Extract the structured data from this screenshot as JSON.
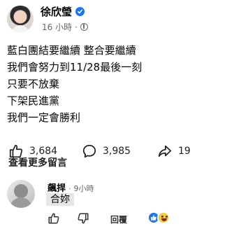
{
  "post": {
    "author": "徐欣瑩",
    "time": "16 小時",
    "lines": [
      "藍白團結要繼續 整合要繼續",
      "我們會努力到11/28最後一刻",
      "只要不放棄",
      "下架民進黨",
      "我們一定會勝利"
    ]
  },
  "stats": {
    "likes": "3,684",
    "comments": "3,985",
    "shares": "19"
  },
  "more_comments": "查看更多留言",
  "comment": {
    "author": "飆捍",
    "time": "9小時",
    "text": "合妳",
    "reply_label": "回覆"
  },
  "icons": {
    "verified": "verified-badge-icon",
    "audience": "globe-icon",
    "like": "thumbs-up-icon",
    "comment": "speech-bubble-icon",
    "share": "share-arrow-icon",
    "dislike": "thumbs-down-icon",
    "reaction_like": "like-reaction-icon",
    "reaction_haha": "haha-reaction-icon"
  },
  "colors": {
    "accent": "#1877f2",
    "secondary_text": "#65676b"
  }
}
